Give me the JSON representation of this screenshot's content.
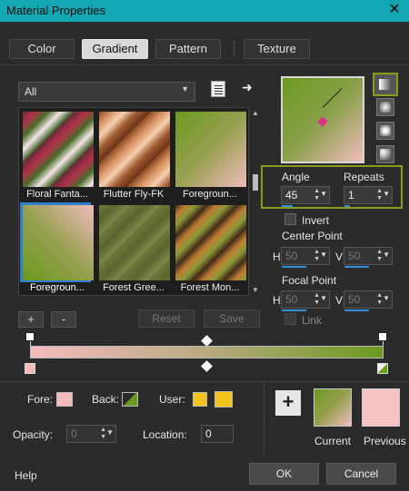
{
  "window": {
    "title": "Material Properties",
    "close_glyph": "✕"
  },
  "tabs": [
    {
      "label": "Color"
    },
    {
      "label": "Gradient",
      "active": true
    },
    {
      "label": "Pattern"
    },
    {
      "label": "Texture"
    }
  ],
  "filter": {
    "value": "All"
  },
  "swatches": [
    {
      "label": "Floral Fanta...",
      "icon": "gradient-swatch"
    },
    {
      "label": "Flutter Fly-FK",
      "icon": "gradient-swatch"
    },
    {
      "label": "Foregroun...",
      "icon": "gradient-swatch"
    },
    {
      "label": "Foregroun...",
      "icon": "gradient-swatch",
      "selected": true
    },
    {
      "label": "Forest Gree...",
      "icon": "gradient-swatch"
    },
    {
      "label": "Forest Mon...",
      "icon": "gradient-swatch"
    }
  ],
  "list_buttons": {
    "add": "+",
    "remove": "-",
    "reset": "Reset",
    "save": "Save"
  },
  "angle": {
    "label": "Angle",
    "value": "45"
  },
  "repeats": {
    "label": "Repeats",
    "value": "1"
  },
  "invert": {
    "label": "Invert",
    "checked": false
  },
  "center_point": {
    "label": "Center Point",
    "h_label": "H",
    "h_value": "50",
    "v_label": "V",
    "v_value": "50"
  },
  "focal_point": {
    "label": "Focal Point",
    "h_label": "H",
    "h_value": "50",
    "v_label": "V",
    "v_value": "50"
  },
  "link": {
    "label": "Link",
    "checked": false
  },
  "fore": {
    "label": "Fore:",
    "color": "#f3bcbc"
  },
  "back": {
    "label": "Back:",
    "color": "#6a9a1e"
  },
  "user": {
    "label": "User:",
    "color": "#f2c21a"
  },
  "opacity": {
    "label": "Opacity:",
    "value": "0"
  },
  "location": {
    "label": "Location:",
    "value": "0"
  },
  "current": {
    "label": "Current"
  },
  "previous": {
    "label": "Previous",
    "color": "#f7c2c2"
  },
  "footer": {
    "help": "Help",
    "ok": "OK",
    "cancel": "Cancel"
  },
  "colors": {
    "accent": "#12a7b2",
    "selection": "#2f7fcf",
    "highlight": "#8b9a1d"
  }
}
